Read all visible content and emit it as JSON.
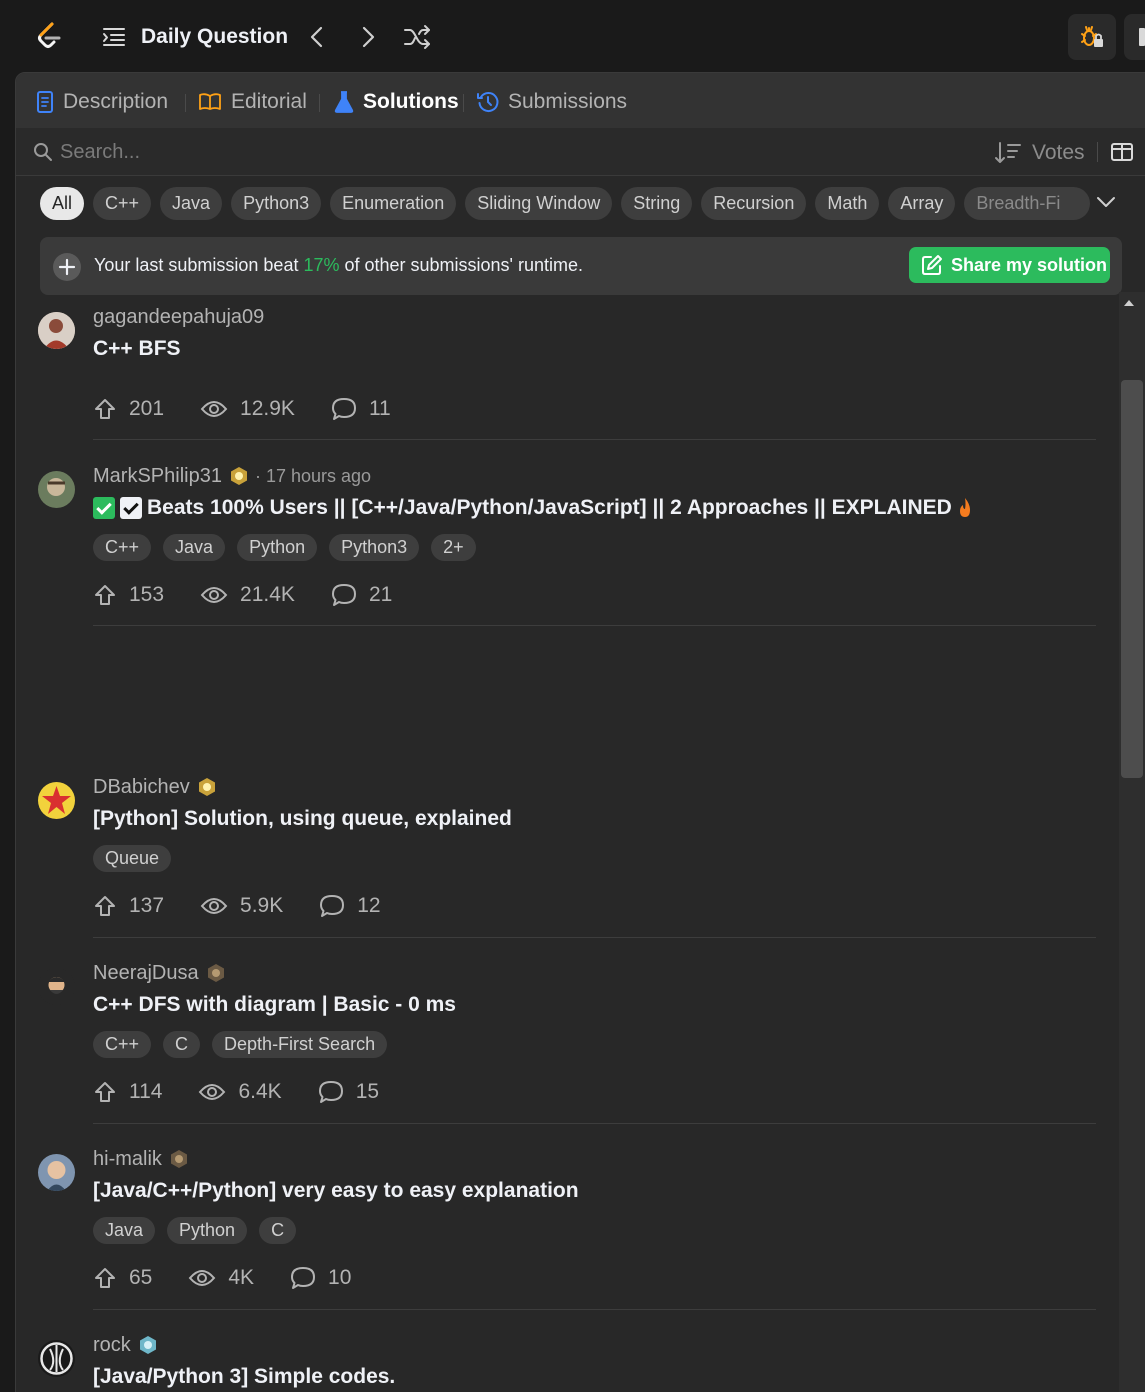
{
  "topbar": {
    "title": "Daily Question"
  },
  "tabs": [
    {
      "label": "Description"
    },
    {
      "label": "Editorial"
    },
    {
      "label": "Solutions"
    },
    {
      "label": "Submissions"
    }
  ],
  "search": {
    "placeholder": "Search..."
  },
  "sort": {
    "label": "Votes"
  },
  "chips": [
    "All",
    "C++",
    "Java",
    "Python3",
    "Enumeration",
    "Sliding Window",
    "String",
    "Recursion",
    "Math",
    "Array",
    "Breadth-Fi"
  ],
  "banner": {
    "prefix": "Your last submission beat ",
    "percent": "17%",
    "suffix": " of other submissions' runtime.",
    "share_label": "Share my solution"
  },
  "solutions": [
    {
      "author": "gagandeepahuja09",
      "time": "",
      "title": "C++ BFS",
      "tags": [],
      "votes": "201",
      "views": "12.9K",
      "comments": "11"
    },
    {
      "author": "MarkSPhilip31",
      "time": "· 17 hours ago",
      "title": "Beats 100% Users || [C++/Java/Python/JavaScript] || 2 Approaches || EXPLAINED",
      "tags": [
        "C++",
        "Java",
        "Python",
        "Python3",
        "2+"
      ],
      "votes": "153",
      "views": "21.4K",
      "comments": "21"
    },
    {
      "author": "DBabichev",
      "time": "",
      "title": "[Python] Solution, using queue, explained",
      "tags": [
        "Queue"
      ],
      "votes": "137",
      "views": "5.9K",
      "comments": "12"
    },
    {
      "author": "NeerajDusa",
      "time": "",
      "title": "C++ DFS with diagram | Basic - 0 ms",
      "tags": [
        "C++",
        "C",
        "Depth-First Search"
      ],
      "votes": "114",
      "views": "6.4K",
      "comments": "15"
    },
    {
      "author": "hi-malik",
      "time": "",
      "title": "[Java/C++/Python] very easy to easy explanation",
      "tags": [
        "Java",
        "Python",
        "C"
      ],
      "votes": "65",
      "views": "4K",
      "comments": "10"
    },
    {
      "author": "rock",
      "time": "",
      "title": "[Java/Python 3] Simple codes.",
      "tags": [],
      "votes": "",
      "views": "",
      "comments": ""
    }
  ],
  "colors": {
    "accent_green": "#2cbb5d",
    "solutions_tab_blue": "#3f83f8",
    "background": "#1a1a1a",
    "panel": "#282828"
  }
}
